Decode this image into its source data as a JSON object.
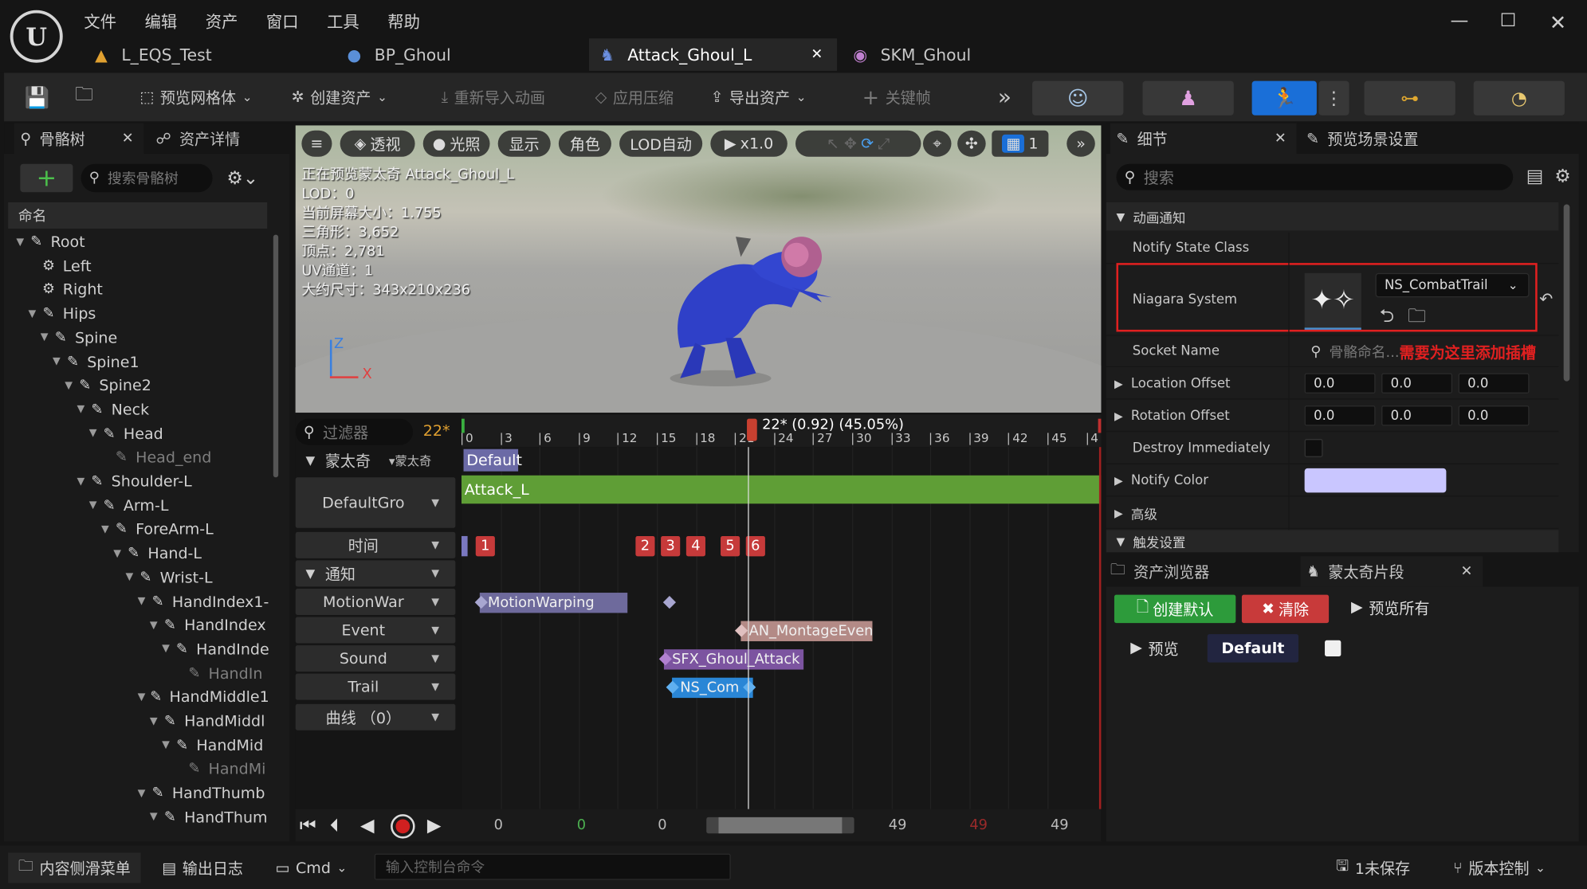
{
  "menu": [
    "文件",
    "编辑",
    "资产",
    "窗口",
    "工具",
    "帮助"
  ],
  "tabs": [
    {
      "label": "L_EQS_Test"
    },
    {
      "label": "BP_Ghoul"
    },
    {
      "label": "Attack_Ghoul_L",
      "active": true
    },
    {
      "label": "SKM_Ghoul"
    }
  ],
  "toolbar": {
    "preview_mesh": "预览网格体",
    "create_asset": "创建资产",
    "reimport": "重新导入动画",
    "apply_compression": "应用压缩",
    "export_asset": "导出资产",
    "keyframe": "关键帧"
  },
  "left_panel": {
    "tab_skeleton": "骨骼树",
    "tab_asset_details": "资产详情",
    "search_placeholder": "搜索骨骼树",
    "column_header": "命名",
    "bones": [
      {
        "name": "Root",
        "depth": 0,
        "type": "bone"
      },
      {
        "name": "Left",
        "depth": 1,
        "type": "socket"
      },
      {
        "name": "Right",
        "depth": 1,
        "type": "socket"
      },
      {
        "name": "Hips",
        "depth": 1,
        "type": "bone"
      },
      {
        "name": "Spine",
        "depth": 2,
        "type": "bone"
      },
      {
        "name": "Spine1",
        "depth": 3,
        "type": "bone"
      },
      {
        "name": "Spine2",
        "depth": 4,
        "type": "bone"
      },
      {
        "name": "Neck",
        "depth": 5,
        "type": "bone"
      },
      {
        "name": "Head",
        "depth": 6,
        "type": "bone"
      },
      {
        "name": "Head_end",
        "depth": 7,
        "type": "leaf"
      },
      {
        "name": "Shoulder-L",
        "depth": 5,
        "type": "bone"
      },
      {
        "name": "Arm-L",
        "depth": 6,
        "type": "bone"
      },
      {
        "name": "ForeArm-L",
        "depth": 7,
        "type": "bone"
      },
      {
        "name": "Hand-L",
        "depth": 8,
        "type": "bone"
      },
      {
        "name": "Wrist-L",
        "depth": 9,
        "type": "bone"
      },
      {
        "name": "HandIndex1-",
        "depth": 10,
        "type": "bone"
      },
      {
        "name": "HandIndex",
        "depth": 11,
        "type": "bone"
      },
      {
        "name": "HandInde",
        "depth": 12,
        "type": "bone"
      },
      {
        "name": "HandIn",
        "depth": 13,
        "type": "leaf"
      },
      {
        "name": "HandMiddle1",
        "depth": 10,
        "type": "bone"
      },
      {
        "name": "HandMiddl",
        "depth": 11,
        "type": "bone"
      },
      {
        "name": "HandMid",
        "depth": 12,
        "type": "bone"
      },
      {
        "name": "HandMi",
        "depth": 13,
        "type": "leaf"
      },
      {
        "name": "HandThumb",
        "depth": 10,
        "type": "bone"
      },
      {
        "name": "HandThum",
        "depth": 11,
        "type": "bone"
      }
    ]
  },
  "viewport": {
    "btn_menu": "≡",
    "btn_perspective": "透视",
    "btn_lit": "光照",
    "btn_show": "显示",
    "btn_character": "角色",
    "btn_lod": "LOD自动",
    "btn_speed": "x1.0",
    "grid_count": "1",
    "info": [
      "正在预览蒙太奇 Attack_Ghoul_L",
      "LOD：0",
      "当前屏幕大小：1.755",
      "三角形：3,652",
      "顶点：2,781",
      "UV通道：1",
      "大约尺寸：343x210x236"
    ],
    "axis_z": "Z",
    "axis_x": "X"
  },
  "timeline": {
    "filter_placeholder": "过滤器",
    "frame_badge": "22*",
    "playhead_label": "22* (0.92) (45.05%)",
    "ruler_ticks": [
      "0",
      "3",
      "6",
      "9",
      "12",
      "15",
      "18",
      "21",
      "24",
      "27",
      "30",
      "33",
      "36",
      "39",
      "42",
      "45",
      "4"
    ],
    "montage_header": "蒙太奇",
    "montage_dropdown": "蒙太奇",
    "default_section": "Default",
    "slot_group": "DefaultGro",
    "segment_label": "Attack_L",
    "time_label": "时间",
    "notify_label": "通知",
    "numbers": [
      "1",
      "2",
      "3",
      "4",
      "5",
      "6"
    ],
    "notify_tracks": [
      "MotionWar",
      "Event",
      "Sound",
      "Trail"
    ],
    "curves_label": "曲线 （0）",
    "notifies": [
      {
        "label": "MotionWarping",
        "color": "#6e6a9c"
      },
      {
        "label": "AN_MontageEvent",
        "color": "#b38a86"
      },
      {
        "label": "SFX_Ghoul_Attack",
        "color": "#7c54a0"
      },
      {
        "label": "NS_Com",
        "color": "#2a86d6"
      }
    ],
    "transport": {
      "start": "0",
      "green": "0",
      "mid": "0",
      "end1": "49",
      "red": "49",
      "end2": "49"
    }
  },
  "details": {
    "tab_details": "细节",
    "tab_preview_settings": "预览场景设置",
    "search_placeholder": "搜索",
    "section_anim_notify": "动画通知",
    "notify_state_class": "Notify State Class",
    "niagara_system": "Niagara System",
    "niagara_value": "NS_CombatTrail",
    "socket_name": "Socket Name",
    "socket_placeholder": "骨骼命名...",
    "annotation": "需要为这里添加插槽",
    "location_offset": "Location Offset",
    "location_values": [
      "0.0",
      "0.0",
      "0.0"
    ],
    "rotation_offset": "Rotation Offset",
    "rotation_values": [
      "0.0",
      "0.0",
      "0.0"
    ],
    "destroy_immediately": "Destroy Immediately",
    "notify_color": "Notify Color",
    "notify_color_value": "#c9c6ff",
    "advanced": "高级",
    "trigger_settings": "触发设置"
  },
  "lower_right": {
    "tab_asset_browser": "资产浏览器",
    "tab_montage_sections": "蒙太奇片段",
    "create_default": "创建默认",
    "clear": "清除",
    "preview_all": "预览所有",
    "preview": "预览",
    "default_section": "Default"
  },
  "statusbar": {
    "content_drawer": "内容侧滑菜单",
    "output_log": "输出日志",
    "cmd": "Cmd",
    "console_placeholder": "输入控制台命令",
    "unsaved": "1未保存",
    "source_control": "版本控制"
  },
  "colors": {
    "accent_blue": "#1a6fd8",
    "green_button": "#2d9b3b",
    "red_button": "#c83a3a",
    "segment_green": "#5f9e36",
    "annotation_red": "#e02020"
  }
}
